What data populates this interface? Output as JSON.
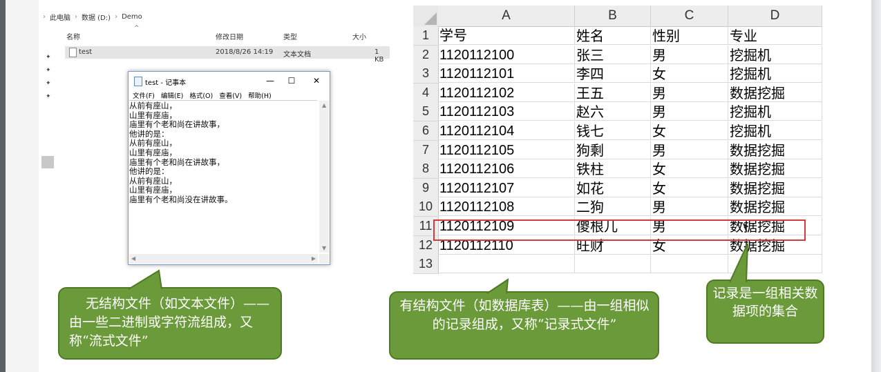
{
  "explorer": {
    "breadcrumb": [
      "此电脑",
      "数据 (D:)",
      "Demo"
    ],
    "columns": {
      "name": "名称",
      "modified": "修改日期",
      "type": "类型",
      "size": "大小"
    },
    "file": {
      "name": "test",
      "modified": "2018/8/26 14:19",
      "type": "文本文档",
      "size": "1 KB"
    }
  },
  "notepad": {
    "title": "test - 记事本",
    "menu": [
      "文件(F)",
      "编辑(E)",
      "格式(O)",
      "查看(V)",
      "帮助(H)"
    ],
    "lines": [
      "从前有座山，",
      "山里有座庙，",
      "庙里有个老和尚在讲故事，",
      "他讲的是：",
      "从前有座山，",
      "山里有座庙，",
      "庙里有个老和尚在讲故事，",
      "他讲的是：",
      "从前有座山，",
      "山里有座庙，",
      "庙里有个老和尚没在讲故事。"
    ]
  },
  "sheet": {
    "columns": [
      "A",
      "B",
      "C",
      "D"
    ],
    "rows": [
      [
        "学号",
        "姓名",
        "性别",
        "专业"
      ],
      [
        "1120112100",
        "张三",
        "男",
        "挖掘机"
      ],
      [
        "1120112101",
        "李四",
        "女",
        "挖掘机"
      ],
      [
        "1120112102",
        "王五",
        "男",
        "数据挖掘"
      ],
      [
        "1120112103",
        "赵六",
        "男",
        "挖掘机"
      ],
      [
        "1120112104",
        "钱七",
        "女",
        "挖掘机"
      ],
      [
        "1120112105",
        "狗剩",
        "男",
        "数据挖掘"
      ],
      [
        "1120112106",
        "铁柱",
        "女",
        "数据挖掘"
      ],
      [
        "1120112107",
        "如花",
        "女",
        "数据挖掘"
      ],
      [
        "1120112108",
        "二狗",
        "男",
        "数据挖掘"
      ],
      [
        "1120112109",
        "傻根儿",
        "男",
        "数据挖掘"
      ],
      [
        "1120112110",
        "旺财",
        "女",
        "数据挖掘"
      ],
      [
        "",
        "",
        "",
        ""
      ]
    ],
    "highlighted_row": 11
  },
  "callouts": {
    "unstructured": "无结构文件（如文本文件）——由一些二进制或字符流组成，又称“流式文件”",
    "structured": "有结构文件（如数据库表）——由一组相似的记录组成，又称“记录式文件”",
    "record": "记录是一组相关数据项的集合"
  },
  "colors": {
    "callout_fill": "#6a9a39",
    "highlight": "#d43a3a"
  }
}
